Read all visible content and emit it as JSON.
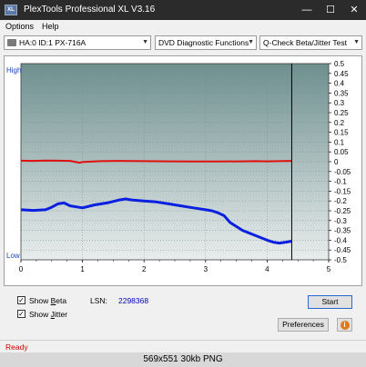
{
  "window": {
    "title": "PlexTools Professional XL V3.16",
    "icon_label": "XL",
    "controls": {
      "minimize": "—",
      "maximize": "☐",
      "close": "✕"
    }
  },
  "menu": {
    "options": "Options",
    "help": "Help"
  },
  "toolbar": {
    "drive": "HA:0 ID:1  PX-716A",
    "function": "DVD Diagnostic Functions",
    "test": "Q-Check Beta/Jitter Test",
    "dropdown_icon": "chevron-down-icon"
  },
  "chart_data": {
    "type": "line",
    "background_gradient": [
      "#6e8f8f",
      "#e8ecec"
    ],
    "x_label_ticks": [
      "0",
      "1",
      "2",
      "3",
      "4",
      "5"
    ],
    "xlim": [
      0,
      5
    ],
    "ylim": [
      -0.5,
      0.5
    ],
    "y_ticks": [
      "0.5",
      "0.45",
      "0.4",
      "0.35",
      "0.3",
      "0.25",
      "0.2",
      "0.15",
      "0.1",
      "0.05",
      "0",
      "-0.05",
      "-0.1",
      "-0.15",
      "-0.2",
      "-0.25",
      "-0.3",
      "-0.35",
      "-0.4",
      "-0.45",
      "-0.5"
    ],
    "left_labels": {
      "high": "High",
      "low": "Low"
    },
    "end_marker_x": 4.4,
    "grid": true,
    "series": [
      {
        "color": "#e01010",
        "x": [
          0,
          0.2,
          0.4,
          0.6,
          0.8,
          0.95,
          1.0,
          1.1,
          1.3,
          1.6,
          2.0,
          2.4,
          2.8,
          3.2,
          3.6,
          3.8,
          4.0,
          4.2,
          4.4
        ],
        "y": [
          0.005,
          0.004,
          0.006,
          0.005,
          0.004,
          -0.005,
          -0.002,
          0.0,
          0.003,
          0.004,
          0.003,
          0.002,
          0.001,
          0.001,
          0.002,
          0.003,
          0.002,
          0.003,
          0.004
        ]
      },
      {
        "color": "#0a20e0",
        "x": [
          0,
          0.2,
          0.4,
          0.5,
          0.6,
          0.7,
          0.8,
          1.0,
          1.2,
          1.4,
          1.6,
          1.7,
          1.8,
          2.0,
          2.2,
          2.4,
          2.6,
          2.8,
          3.0,
          3.1,
          3.2,
          3.3,
          3.4,
          3.6,
          3.8,
          4.0,
          4.1,
          4.2,
          4.3,
          4.4
        ],
        "y": [
          -0.245,
          -0.248,
          -0.245,
          -0.232,
          -0.215,
          -0.21,
          -0.225,
          -0.235,
          -0.22,
          -0.21,
          -0.195,
          -0.19,
          -0.195,
          -0.2,
          -0.205,
          -0.215,
          -0.225,
          -0.235,
          -0.245,
          -0.25,
          -0.26,
          -0.275,
          -0.31,
          -0.35,
          -0.375,
          -0.4,
          -0.41,
          -0.415,
          -0.41,
          -0.405
        ]
      }
    ]
  },
  "options": {
    "show_beta": {
      "prefix": "Show ",
      "key": "B",
      "rest": "eta",
      "checked": "✓"
    },
    "show_jitter": {
      "prefix": "Show ",
      "key": "J",
      "rest": "itter",
      "checked": "✓"
    }
  },
  "lsn": {
    "label": "LSN:",
    "value": "2298368"
  },
  "buttons": {
    "start": "Start",
    "preferences": "Preferences",
    "info": "i"
  },
  "status": {
    "text": "Ready"
  },
  "caption": {
    "text": "569x551  30kb  PNG"
  }
}
